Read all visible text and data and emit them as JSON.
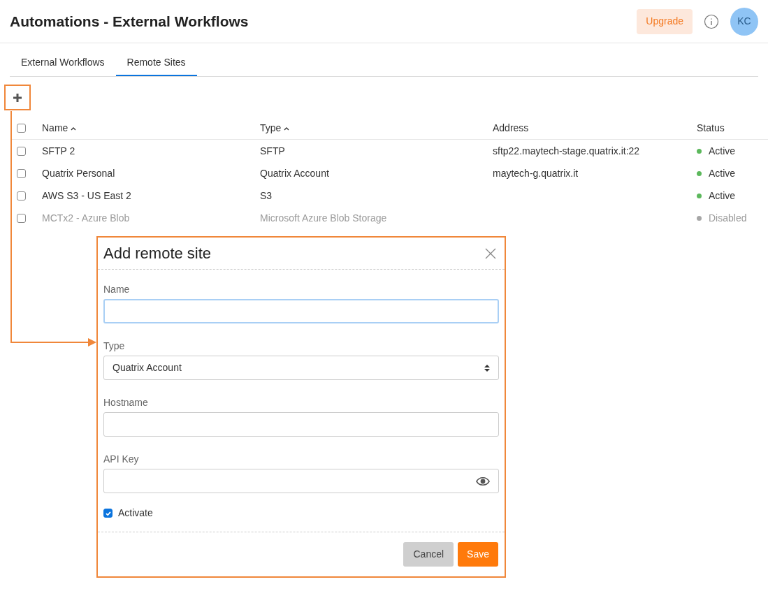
{
  "header": {
    "title": "Automations - External Workflows",
    "upgrade_button": "Upgrade",
    "avatar": "KC"
  },
  "tabs": [
    {
      "label": "External Workflows",
      "selected": false
    },
    {
      "label": "Remote Sites",
      "selected": true
    }
  ],
  "table": {
    "select_all_checked": false,
    "columns": [
      {
        "label": "Name",
        "sorted": true
      },
      {
        "label": "Type",
        "sorted": true
      },
      {
        "label": "Address",
        "sorted": false
      },
      {
        "label": "Status",
        "sorted": false
      }
    ],
    "rows": [
      {
        "checked": false,
        "disabled": false,
        "name": "SFTP 2",
        "type": "SFTP",
        "address": "sftp22.maytech-stage.quatrix.it:22",
        "status": "Active",
        "color": "#5cb85c"
      },
      {
        "checked": false,
        "disabled": false,
        "name": "Quatrix Personal",
        "type": "Quatrix Account",
        "address": "maytech-g.quatrix.it",
        "status": "Active",
        "color": "#5cb85c"
      },
      {
        "checked": false,
        "disabled": false,
        "name": "AWS S3 - US East 2",
        "type": "S3",
        "status": "Active",
        "color": "#5cb85c"
      },
      {
        "checked": false,
        "disabled": true,
        "name": "MCTx2 - Azure Blob",
        "type": "Microsoft Azure Blob Storage",
        "status": "Disabled",
        "color": "#a6a6a6"
      }
    ]
  },
  "dialog": {
    "title": "Add remote site",
    "fields": [
      {
        "kind": "text",
        "label": "Name",
        "focused": true
      },
      {
        "kind": "select",
        "label": "Type",
        "value": "Quatrix Account",
        "focused": false
      },
      {
        "kind": "text",
        "label": "Hostname",
        "focused": false
      },
      {
        "kind": "secret",
        "label": "API Key",
        "focused": false
      }
    ],
    "activate": {
      "label": "Activate",
      "checked": true
    },
    "buttons": {
      "cancel": "Cancel",
      "save": "Save"
    }
  }
}
